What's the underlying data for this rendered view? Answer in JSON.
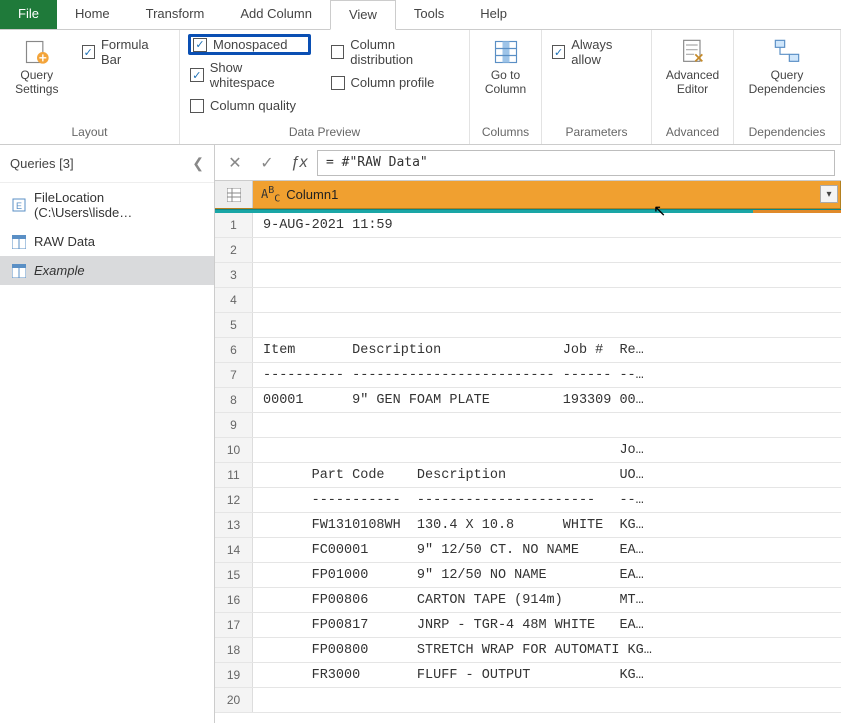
{
  "tabs": {
    "file": "File",
    "home": "Home",
    "transform": "Transform",
    "addcolumn": "Add Column",
    "view": "View",
    "tools": "Tools",
    "help": "Help"
  },
  "ribbon": {
    "layout": {
      "label": "Layout",
      "query_settings": "Query\nSettings",
      "formula_bar": "Formula Bar"
    },
    "data_preview": {
      "label": "Data Preview",
      "monospaced": "Monospaced",
      "show_whitespace": "Show whitespace",
      "column_quality": "Column quality",
      "column_distribution": "Column distribution",
      "column_profile": "Column profile"
    },
    "columns": {
      "label": "Columns",
      "goto_column": "Go to\nColumn"
    },
    "parameters": {
      "label": "Parameters",
      "always_allow": "Always allow"
    },
    "advanced": {
      "label": "Advanced",
      "advanced_editor": "Advanced\nEditor"
    },
    "dependencies": {
      "label": "Dependencies",
      "query_dependencies": "Query\nDependencies"
    }
  },
  "queries": {
    "header": "Queries [3]",
    "items": [
      {
        "label": "FileLocation (C:\\Users\\lisde…",
        "type": "param"
      },
      {
        "label": "RAW Data",
        "type": "table"
      },
      {
        "label": "Example",
        "type": "table",
        "selected": true
      }
    ]
  },
  "formula_bar": {
    "value": "= #\"RAW Data\""
  },
  "grid": {
    "column_header": "Column1",
    "rows": [
      "9-AUG-2021 11:59",
      "",
      "",
      "",
      "",
      "Item       Description               Job #  Re…",
      "---------- ------------------------- ------ --…",
      "00001      9\" GEN FOAM PLATE         193309 00…",
      "",
      "                                            Jo…",
      "      Part Code    Description              UO…",
      "      -----------  ----------------------   --…",
      "      FW1310108WH  130.4 X 10.8      WHITE  KG…",
      "      FC00001      9\" 12/50 CT. NO NAME     EA…",
      "      FP01000      9\" 12/50 NO NAME         EA…",
      "      FP00806      CARTON TAPE (914m)       MT…",
      "      FP00817      JNRP - TGR-4 48M WHITE   EA…",
      "      FP00800      STRETCH WRAP FOR AUTOMATI KG…",
      "      FR3000       FLUFF - OUTPUT           KG…",
      ""
    ]
  }
}
